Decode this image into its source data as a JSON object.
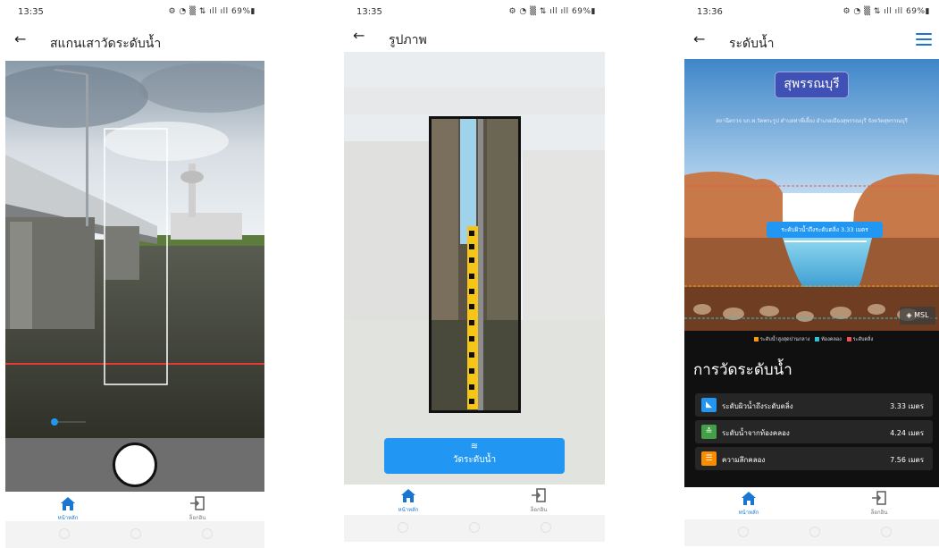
{
  "screens": [
    {
      "status": {
        "time": "13:35",
        "indicators": "⚙ ◔ ▒ ⇅ ıll ıll 69%▮"
      },
      "title": "สแกนเสาวัดระดับน้ำ",
      "back_icon": "arrow-left-icon"
    },
    {
      "status": {
        "time": "13:35",
        "indicators": "⚙ ◔ ▒ ⇅ ıll ıll 69%▮"
      },
      "title": "รูปภาพ",
      "back_icon": "arrow-left-icon",
      "measure_button": {
        "label": "วัดระดับน้ำ",
        "icon": "waves-icon"
      }
    },
    {
      "status": {
        "time": "13:36",
        "indicators": "⚙ ◔ ▒ ⇅ ıll ıll 69%▮"
      },
      "title": "ระดับน้ำ",
      "back_icon": "arrow-left-icon",
      "menu_icon": "hamburger-menu-icon",
      "province": "สุพรรณบุรี",
      "station": "สถานีตรวจ บก.ท.วัดพระรูป ตำบลท่าพี่เลี้ยง อำเภอเมืองสุพรรณบุรี จังหวัดสุพรรณบุรี",
      "tooltip": "ระดับผิวน้ำถึงระดับตลิ่ง 3.33 เมตร",
      "msl_label": "MSL",
      "legend": [
        {
          "label": "ระดับน้ำสูงสุดปานกลาง",
          "color": "#ff9800"
        },
        {
          "label": "ท้องคลอง",
          "color": "#26c6da"
        },
        {
          "label": "ระดับตลิ่ง",
          "color": "#ef5350"
        }
      ],
      "section_title": "การวัดระดับน้ำ",
      "measurements": [
        {
          "label": "ระดับผิวน้ำถึงระดับตลิ่ง",
          "value": "3.33 เมตร",
          "icon": "slope-icon",
          "color": "#2196f3"
        },
        {
          "label": "ระดับน้ำจากท้องคลอง",
          "value": "4.24 เมตร",
          "icon": "water-level-icon",
          "color": "#43a047"
        },
        {
          "label": "ความลึกคลอง",
          "value": "7.56 เมตร",
          "icon": "depth-icon",
          "color": "#fb8c00"
        }
      ]
    }
  ],
  "nav": {
    "home_label": "หน้าหลัก",
    "login_label": "ล็อกอิน",
    "colors": {
      "accent": "#1976d2",
      "primary_button": "#2196f3"
    }
  }
}
